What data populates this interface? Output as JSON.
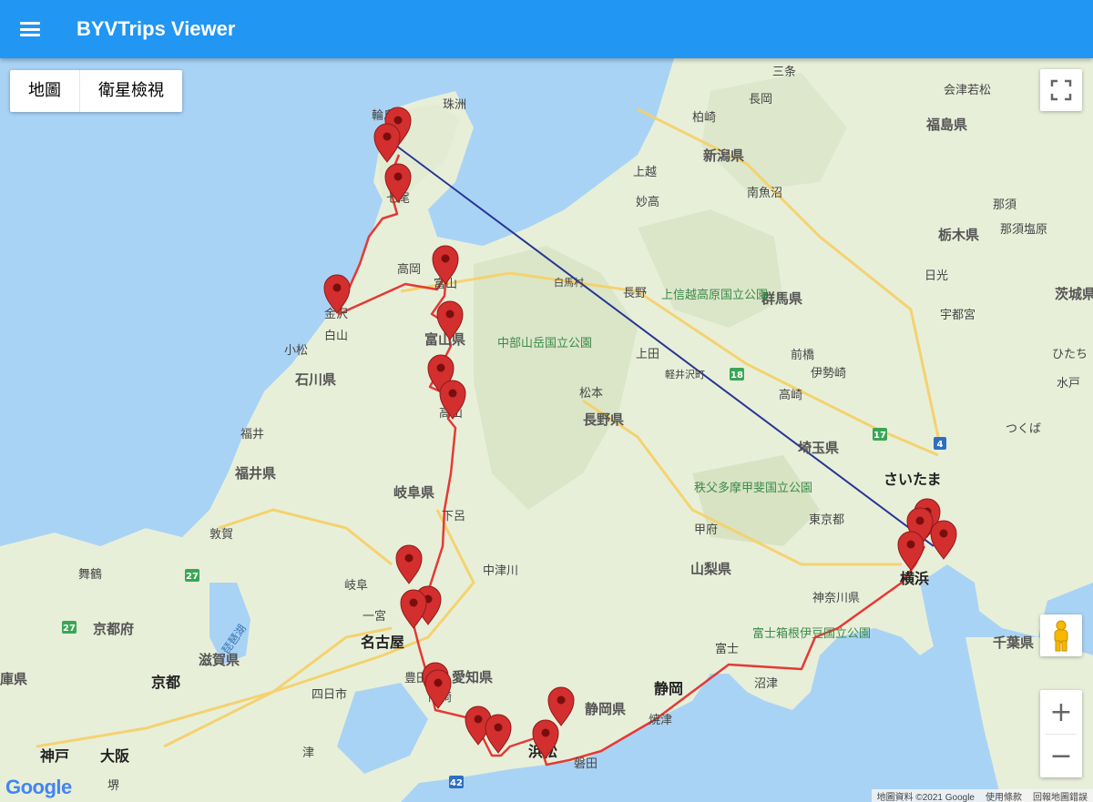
{
  "app": {
    "title": "BYVTrips Viewer"
  },
  "map_type": {
    "map_label": "地圖",
    "satellite_label": "衛星檢視"
  },
  "zoom": {
    "in_label": "+",
    "out_label": "−"
  },
  "attribution": {
    "data": "地圖資料 ©2021 Google",
    "terms": "使用條款",
    "report": "回報地圖錯誤"
  },
  "google_logo": "Google",
  "icons": {
    "menu": "menu-icon",
    "fullscreen": "fullscreen-icon",
    "pegman": "pegman-icon",
    "marker": "map-pin-icon"
  },
  "colors": {
    "appbar": "#2196f3",
    "route": "#e53935",
    "flight_line": "#283593",
    "marker": "#d32f2f",
    "sea": "#a9d3f5",
    "land": "#e8efd9"
  },
  "place_labels": {
    "sanjo": "三条",
    "nagaoka": "長岡",
    "kashiwazaki": "柏崎",
    "niigata": "新潟県",
    "joetsu": "上越",
    "myoko": "妙高",
    "uonuma": "南魚沼",
    "aizu": "会津若松",
    "fukushima": "福島県",
    "nasu": "那須",
    "nasushiobara": "那須塩原",
    "tochigi": "栃木県",
    "nikko": "日光",
    "ibaraki": "茨城県",
    "utsunomiya": "宇都宮",
    "gunma": "群馬県",
    "maebashi": "前橋",
    "isesaki": "伊勢崎",
    "takasaki": "高崎",
    "mito": "水戸",
    "hitachi": "ひたち",
    "tsukuba": "つくば",
    "saitama_pref": "埼玉県",
    "saitama": "さいたま",
    "tokyo": "東京都",
    "kanagawa": "神奈川県",
    "yokohama": "横浜",
    "chiba": "千葉県",
    "fuji": "富士",
    "fujihakone": "富士箱根伊豆国立公園",
    "numazu": "沼津",
    "shizuoka_city": "静岡",
    "shizuoka_pref": "静岡県",
    "yaizu": "焼津",
    "hamamatsu": "浜松",
    "iwata": "磐田",
    "chichibu": "秩父多摩甲斐国立公園",
    "kofu": "甲府",
    "yamanashi": "山梨県",
    "nagano": "長野",
    "nagano_pref": "長野県",
    "joshinetsu": "上信越高原国立公園",
    "ueda": "上田",
    "karuizawa": "軽井沢町",
    "matsumoto": "松本",
    "chubu": "中部山岳国立公園",
    "hakuba": "白馬村",
    "nakatsugawa": "中津川",
    "gifu_pref": "岐阜県",
    "gero": "下呂",
    "takayama": "高山",
    "toyama_pref": "富山県",
    "toyama": "富山",
    "takaoka": "高岡",
    "kanazawa": "金沢",
    "hakusan": "白山",
    "komatsu": "小松",
    "ishikawa": "石川県",
    "fukui_city": "福井",
    "fukui_pref": "福井県",
    "suzu": "珠洲",
    "wajima": "輪島",
    "nanao": "七尾",
    "tsuruga": "敦賀",
    "maizuru": "舞鶴",
    "kyoto_pref": "京都府",
    "biwako": "琵琶湖",
    "shiga": "滋賀県",
    "kyoto": "京都",
    "gifu": "岐阜",
    "ichinomiya": "一宮",
    "nagoya": "名古屋",
    "toyota": "豊田",
    "aichi": "愛知県",
    "okazaki": "岡崎",
    "yokkaichi": "四日市",
    "kobe": "神戸",
    "osaka": "大阪",
    "sakai": "堺",
    "hyogo": "庫県",
    "tsu": "津"
  },
  "road_shields": [
    "18",
    "17",
    "4",
    "27",
    "27",
    "42"
  ]
}
